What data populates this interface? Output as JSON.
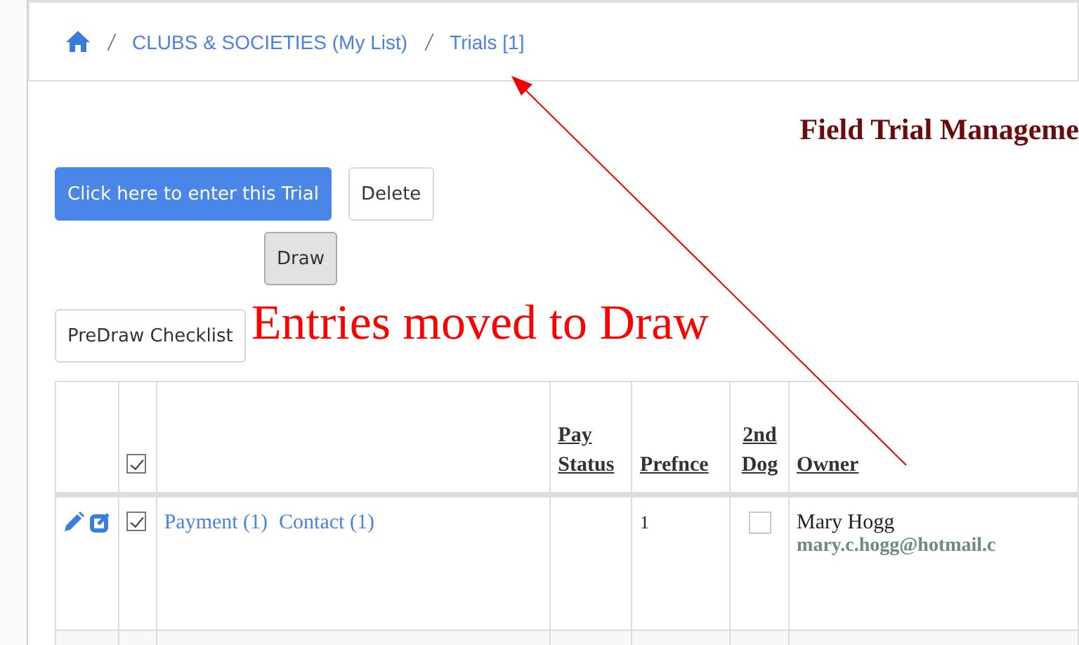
{
  "breadcrumb": [
    {
      "kind": "home"
    },
    {
      "kind": "link",
      "label": "CLUBS & SOCIETIES (My List)"
    },
    {
      "kind": "link",
      "label": "Trials [1]"
    }
  ],
  "heading": "Field Trial Manageme",
  "buttons": [
    {
      "kind": "primary",
      "label": "Click here to enter this Trial"
    },
    {
      "kind": "default",
      "label": "Delete"
    },
    {
      "kind": "pressed",
      "label": "Draw"
    },
    {
      "kind": "default",
      "label": "PreDraw Checklist"
    }
  ],
  "annotation": {
    "text": "Entries moved to Draw"
  },
  "table": {
    "select_all": {
      "checked": true
    },
    "columns": [
      {
        "label": "Pay Status"
      },
      {
        "label": "Prefnce"
      },
      {
        "label": "2nd Dog"
      },
      {
        "label": "Owner"
      }
    ],
    "rows": [
      {
        "checked": true,
        "links": [
          "Payment (1)",
          "Contact (1)"
        ],
        "preference": "1",
        "second_dog": false,
        "owner": "Mary Hogg",
        "email": "mary.c.hogg@hotmail.c"
      }
    ]
  }
}
